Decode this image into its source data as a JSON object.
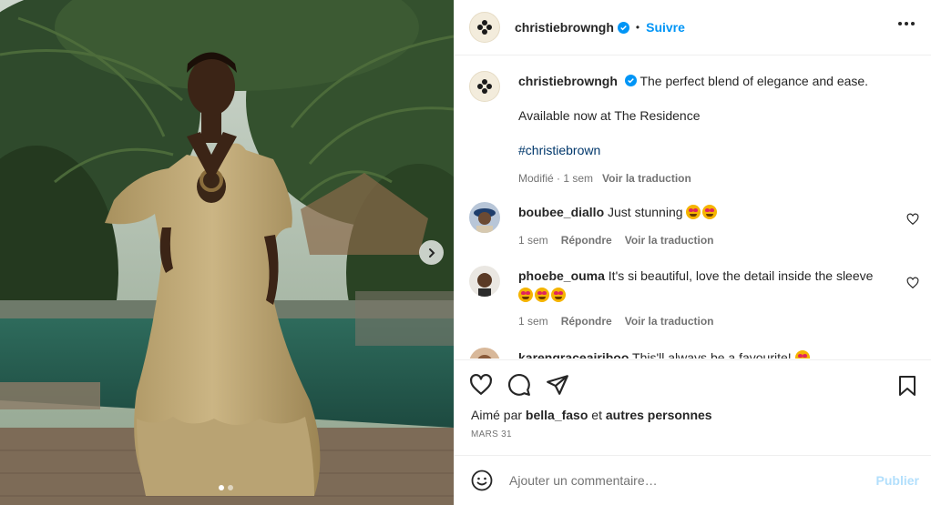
{
  "post": {
    "author": "christiebrowngh",
    "follow_label": "Suivre",
    "separator": "•",
    "caption_text": "The perfect blend of elegance and ease.",
    "caption_line2": "Available now at The Residence",
    "hashtag": "#christiebrown",
    "meta_modified": "Modifié · 1 sem",
    "translate_label": "Voir la traduction"
  },
  "comments": [
    {
      "user": "boubee_diallo",
      "text": "Just stunning",
      "emoji_count": 2,
      "time": "1 sem",
      "reply_label": "Répondre",
      "translate_label": "Voir la traduction"
    },
    {
      "user": "phoebe_ouma",
      "text": "It's si beautiful, love the detail inside the sleeve",
      "emoji_count": 3,
      "time": "1 sem",
      "reply_label": "Répondre",
      "translate_label": "Voir la traduction"
    },
    {
      "user": "karengraceairiboo",
      "text": "This'll always be a favourite!",
      "emoji_count": 1
    }
  ],
  "likes": {
    "prefix": "Aimé par",
    "user": "bella_faso",
    "conjunction": "et",
    "suffix": "autres personnes"
  },
  "date": "MARS 31",
  "add_comment": {
    "placeholder": "Ajouter un commentaire…",
    "post_label": "Publier"
  },
  "carousel": {
    "current": 1,
    "total": 2
  },
  "icons": [
    "heart-icon",
    "comment-icon",
    "share-icon",
    "bookmark-icon",
    "emoji-icon",
    "more-icon",
    "verified-icon",
    "chevron-right-icon"
  ],
  "colors": {
    "accent": "#0095f6",
    "verified": "#0095f6",
    "link": "#00376b",
    "muted": "#737373"
  }
}
